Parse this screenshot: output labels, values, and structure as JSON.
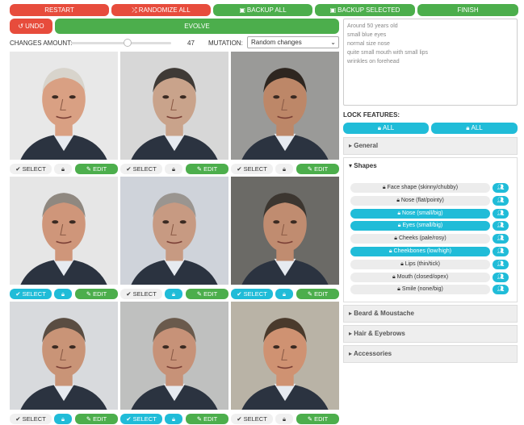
{
  "toolbar": {
    "restart": "RESTART",
    "randomize_all": "RANDOMIZE ALL",
    "backup_all": "BACKUP ALL",
    "backup_selected": "BACKUP SELECTED",
    "finish": "FINISH",
    "undo": "UNDO",
    "evolve": "EVOLVE"
  },
  "controls": {
    "changes_label": "CHANGES AMOUNT:",
    "changes_value": "47",
    "changes_fraction": 0.47,
    "mutation_label": "MUTATION:",
    "mutation_selected": "Random changes"
  },
  "description": {
    "lines": [
      "Around 50 years old",
      "small blue eyes",
      "normal size nose",
      "quite small mouth with small lips",
      "wrinkles on forehead"
    ]
  },
  "grid": {
    "select_label": "SELECT",
    "edit_label": "EDIT",
    "cells": [
      {
        "selected": false,
        "locked": false,
        "bg": "#e8e8e8",
        "skin": "#d9a083",
        "hair": "#d8d4cc"
      },
      {
        "selected": false,
        "locked": false,
        "bg": "#d7d7d7",
        "skin": "#c9a38b",
        "hair": "#3f3a36"
      },
      {
        "selected": false,
        "locked": false,
        "bg": "#9a9a98",
        "skin": "#bd8768",
        "hair": "#2e2620"
      },
      {
        "selected": true,
        "locked": true,
        "bg": "#e6e6e6",
        "skin": "#cf967a",
        "hair": "#8f8880"
      },
      {
        "selected": false,
        "locked": true,
        "bg": "#cfd3da",
        "skin": "#c79a82",
        "hair": "#9a9590"
      },
      {
        "selected": true,
        "locked": true,
        "bg": "#6b6a66",
        "skin": "#c08c70",
        "hair": "#3c3630"
      },
      {
        "selected": false,
        "locked": true,
        "bg": "#d8dadd",
        "skin": "#c99477",
        "hair": "#5a4d42"
      },
      {
        "selected": true,
        "locked": true,
        "bg": "#bfc0bf",
        "skin": "#c79278",
        "hair": "#6a5a4c"
      },
      {
        "selected": false,
        "locked": false,
        "bg": "#b9b3a6",
        "skin": "#cf9272",
        "hair": "#4a3a2c"
      }
    ]
  },
  "lock": {
    "title": "LOCK FEATURES:",
    "all_left": "ALL",
    "all_right": "ALL"
  },
  "sections": {
    "general": "General",
    "shapes": "Shapes",
    "beard": "Beard & Moustache",
    "hair": "Hair & Eyebrows",
    "accessories": "Accessories"
  },
  "features": [
    {
      "label": "Face shape (skinny/chubby)",
      "on": false
    },
    {
      "label": "Nose (flat/pointy)",
      "on": false
    },
    {
      "label": "Nose (small/big)",
      "on": true
    },
    {
      "label": "Eyes (small/big)",
      "on": true
    },
    {
      "label": "Cheeks (pale/rosy)",
      "on": false
    },
    {
      "label": "Cheekbones (low/high)",
      "on": true
    },
    {
      "label": "Lips (thin/tick)",
      "on": false
    },
    {
      "label": "Mouth (closed/opex)",
      "on": false
    },
    {
      "label": "Smile (none/big)",
      "on": false
    }
  ]
}
